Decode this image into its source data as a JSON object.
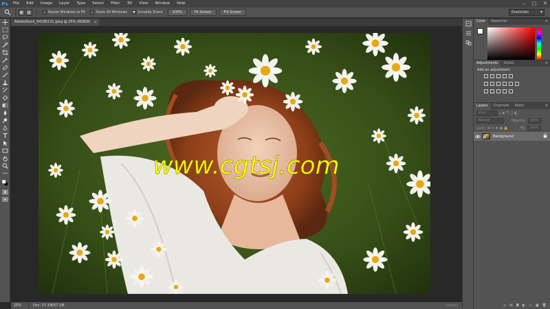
{
  "app": {
    "logo": "Ps"
  },
  "menu": [
    "File",
    "Edit",
    "Image",
    "Layer",
    "Type",
    "Select",
    "Filter",
    "3D",
    "View",
    "Window",
    "Help"
  ],
  "window_controls": [
    "–",
    "□",
    "✕"
  ],
  "options": {
    "resize_windows_label": "Resize Windows to Fit",
    "resize_windows_checked": false,
    "zoom_all_label": "Zoom All Windows",
    "zoom_all_checked": false,
    "scrubby_zoom_label": "Scrubby Zoom",
    "scrubby_zoom_checked": true,
    "zoom_100_label": "100%",
    "fit_screen_label": "Fit Screen",
    "fill_screen_label": "Fill Screen",
    "workspace": "Essentials"
  },
  "document": {
    "tab_title": "AdobeStock_84195131.jpeg @ 25% (RGB/8)",
    "tab_close": "×",
    "overlay_text": "www.cgtsj.com"
  },
  "status": {
    "zoom": "25%",
    "doc_size": "Doc: 57.1M/57.1M",
    "watermark": "udemy"
  },
  "panels": {
    "color_tabs": [
      "Color",
      "Swatches"
    ],
    "adjust_tabs": [
      "Adjustments",
      "Styles"
    ],
    "adjust_title": "Add an adjustment",
    "layers_tabs": [
      "Layers",
      "Channels",
      "Paths"
    ],
    "filter_kind": "Kind",
    "blend_mode": "Normal",
    "opacity_label": "Opacity:",
    "opacity_value": "100%",
    "lock_label": "Lock:",
    "fill_label": "Fill:",
    "fill_value": "100%",
    "layer_name": "Background",
    "panel_menu": "≡"
  },
  "colors": {
    "fg": "#ffffff",
    "bg": "#000000",
    "overlay_text": "#ffff00",
    "ps_blue": "#31a8ff"
  }
}
